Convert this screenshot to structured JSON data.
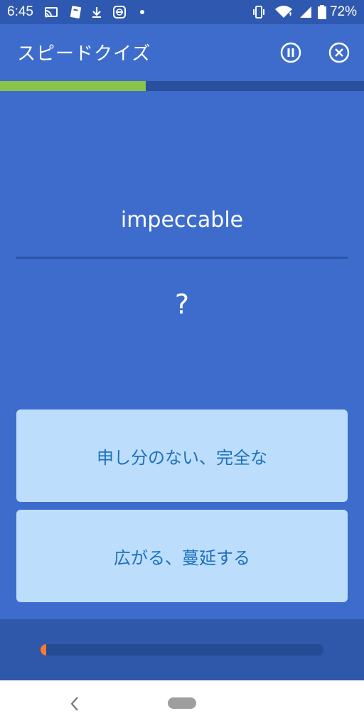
{
  "status_bar": {
    "time": "6:45",
    "battery": "72%",
    "icons_left": [
      "cast-icon",
      "card-icon",
      "download-icon",
      "vpn-icon",
      "dot-icon"
    ],
    "icons_right": [
      "vibrate-icon",
      "wifi-icon",
      "signal-icon",
      "battery-icon"
    ]
  },
  "app_bar": {
    "title": "スピードクイズ",
    "actions": [
      "pause-icon",
      "close-icon"
    ]
  },
  "quiz_progress": 0.4,
  "question": {
    "word": "impeccable",
    "answer_placeholder": "?"
  },
  "choices": [
    {
      "label": "申し分のない、完全な"
    },
    {
      "label": "広がる、蔓延する"
    }
  ],
  "timer_remaining": 0.02,
  "colors": {
    "background": "#3d6ccd",
    "status_bar": "#2f59b0",
    "progress": "#8bc34a",
    "choice_bg": "#bcdefc",
    "choice_text": "#1e6fbd",
    "timer": "#ff7b2a"
  },
  "nav_bar": {
    "icons": [
      "back-icon",
      "home-pill"
    ]
  }
}
